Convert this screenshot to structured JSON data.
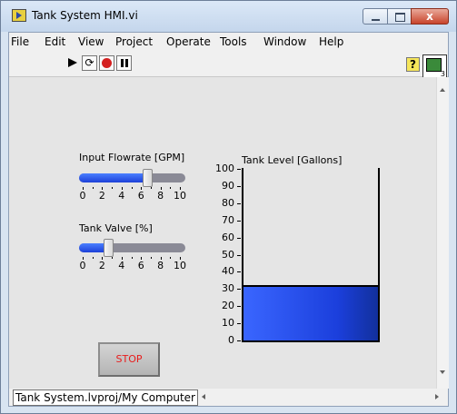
{
  "window": {
    "title": "Tank System HMI.vi",
    "close_glyph": "x"
  },
  "menu": [
    "File",
    "Edit",
    "View",
    "Project",
    "Operate",
    "Tools",
    "Window",
    "Help"
  ],
  "toolbar": {
    "icons": [
      "run-arrow-icon",
      "run-continuously-icon",
      "abort-icon",
      "pause-icon"
    ],
    "help_glyph": "?",
    "run_continuously_glyph": "⟳",
    "connector_pane_label": "3"
  },
  "controls": {
    "input_flowrate": {
      "label": "Input Flowrate [GPM]",
      "min": 0,
      "max": 10,
      "value": 6.6,
      "ticks": [
        "0",
        "2",
        "4",
        "6",
        "8",
        "10"
      ]
    },
    "tank_valve": {
      "label": "Tank Valve [%]",
      "min": 0,
      "max": 10,
      "value": 2.6,
      "ticks": [
        "0",
        "2",
        "4",
        "6",
        "8",
        "10"
      ]
    },
    "stop_button": {
      "label": "STOP"
    }
  },
  "tank": {
    "label": "Tank Level [Gallons]",
    "min": 0,
    "max": 100,
    "value": 32,
    "ticks": [
      "100",
      "90",
      "80",
      "70",
      "60",
      "50",
      "40",
      "30",
      "20",
      "10",
      "0"
    ]
  },
  "status": {
    "context": "Tank System.lvproj/My Computer"
  },
  "colors": {
    "fluid": "#1b3fdc",
    "slider_fill": "#2d55f0",
    "stop_text": "#e81c1c"
  }
}
